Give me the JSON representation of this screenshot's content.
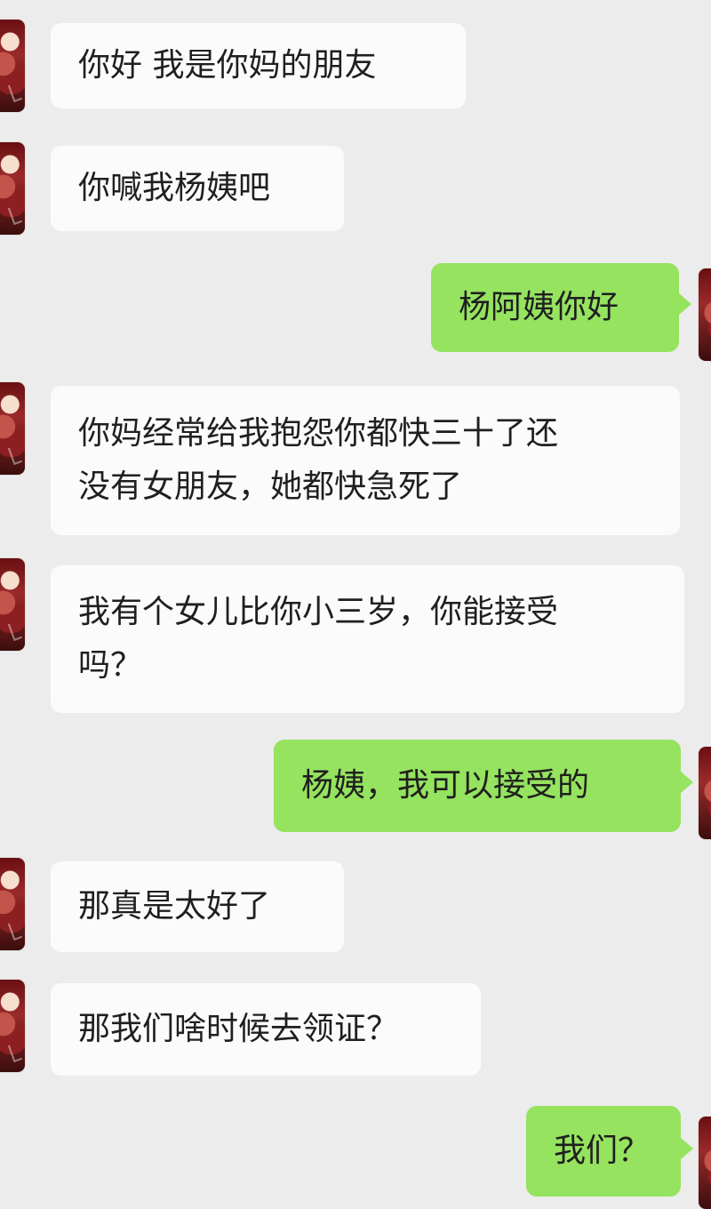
{
  "messages": [
    {
      "side": "left",
      "text": "你好 我是你妈的朋友"
    },
    {
      "side": "left",
      "text": "你喊我杨姨吧"
    },
    {
      "side": "right",
      "text": "杨阿姨你好"
    },
    {
      "side": "left",
      "text": "你妈经常给我抱怨你都快三十了还\n没有女朋友，她都快急死了"
    },
    {
      "side": "left",
      "text": "我有个女儿比你小三岁，你能接受\n吗？"
    },
    {
      "side": "right",
      "text": "杨姨，我可以接受的"
    },
    {
      "side": "left",
      "text": "那真是太好了"
    },
    {
      "side": "left",
      "text": "那我们啥时候去领证？"
    },
    {
      "side": "right",
      "text": "我们？"
    }
  ]
}
